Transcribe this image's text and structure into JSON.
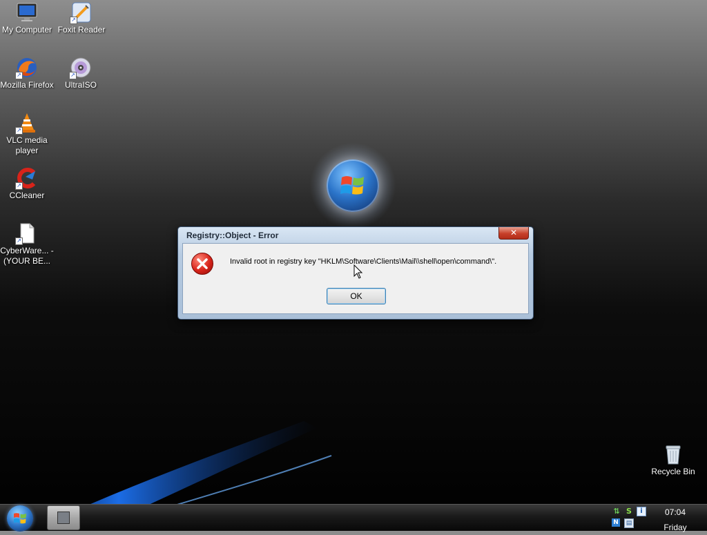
{
  "desktop": {
    "icons": [
      {
        "label": "My Computer"
      },
      {
        "label": "Foxit Reader"
      },
      {
        "label": "Mozilla Firefox"
      },
      {
        "label": "UltraISO"
      },
      {
        "label": "VLC media player"
      },
      {
        "label": "CCleaner"
      },
      {
        "label": "CyberWare... - (YOUR BE..."
      },
      {
        "label": "Recycle Bin"
      }
    ]
  },
  "dialog": {
    "title": "Registry::Object - Error",
    "close_label": "✕",
    "message": "Invalid root in registry key \"HKLM\\Software\\Clients\\Mail\\\\shell\\open\\command\\\".",
    "ok_label": "OK"
  },
  "taskbar": {
    "clock_time": "07:04",
    "clock_day": "Friday",
    "tray_icons": [
      "network-icon",
      "s-app-icon",
      "info-icon",
      "network-icon-2",
      "monitor-icon"
    ]
  },
  "colors": {
    "dialog_frame": "#b7cbe1",
    "error_red": "#d8241b",
    "ok_border": "#3c7fb1",
    "accent_blue": "#2b74c9"
  }
}
